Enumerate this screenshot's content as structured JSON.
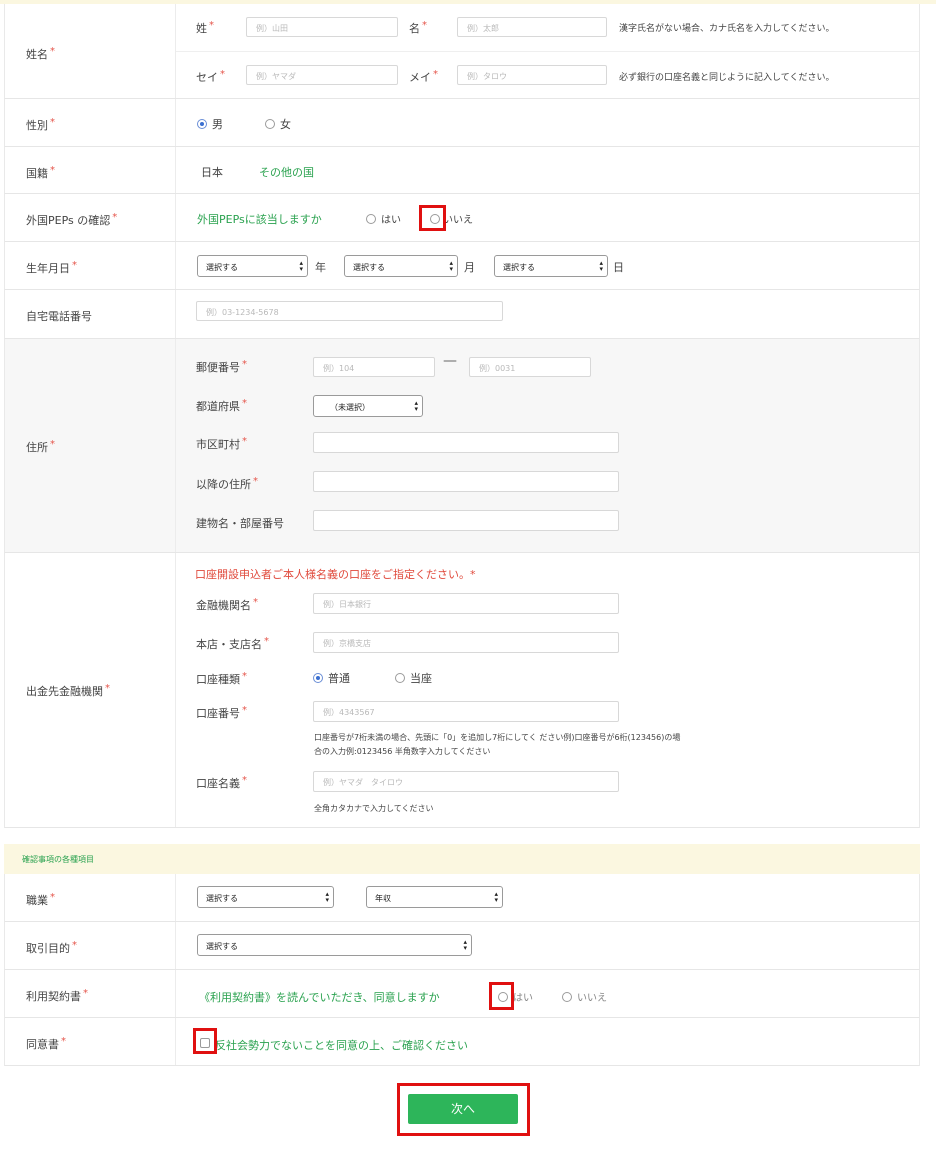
{
  "form": {
    "name": {
      "label": "姓名",
      "sei_label": "姓",
      "sei_placeholder": "例）山田",
      "mei_label": "名",
      "mei_placeholder": "例）太郎",
      "sei_kana_label": "セイ",
      "sei_kana_placeholder": "例）ヤマダ",
      "mei_kana_label": "メイ",
      "mei_kana_placeholder": "例）タロウ",
      "note1": "漢字氏名がない場合、カナ氏名を入力してください。",
      "note2": "必ず銀行の口座名義と同じように記入してください。"
    },
    "gender": {
      "label": "性別",
      "male": "男",
      "female": "女",
      "selected": "男"
    },
    "nationality": {
      "label": "国籍",
      "japan": "日本",
      "other": "その他の国"
    },
    "peps": {
      "label": "外国PEPs の確認",
      "question": "外国PEPsに該当しますか",
      "yes": "はい",
      "no": "いいえ"
    },
    "birth": {
      "label": "生年月日",
      "select": "選択する",
      "year": "年",
      "month": "月",
      "day": "日"
    },
    "phone": {
      "label": "自宅電話番号",
      "placeholder": "例）03-1234-5678"
    },
    "address": {
      "label": "住所",
      "zip_label": "郵便番号",
      "zip1_placeholder": "例）104",
      "zip_dash": "—",
      "zip2_placeholder": "例）0031",
      "pref_label": "都道府県",
      "pref_value": "（未選択）",
      "city_label": "市区町村",
      "street_label": "以降の住所",
      "building_label": "建物名・部屋番号"
    },
    "bank": {
      "label": "出金先金融機関",
      "notice": "口座開設申込者ご本人様名義の口座をご指定ください。*",
      "inst_label": "金融機関名",
      "inst_placeholder": "例）日本銀行",
      "branch_label": "本店・支店名",
      "branch_placeholder": "例）京橋支店",
      "type_label": "口座種類",
      "type_normal": "普通",
      "type_current": "当座",
      "num_label": "口座番号",
      "num_placeholder": "例）4343567",
      "num_note1": "口座番号が7桁未満の場合、先頭に「0」を追加し7桁にしてく ださい例)口座番号が6桁(123456)の場",
      "num_note2": "合の入力例:0123456 半角数字入力してください",
      "holder_label": "口座名義",
      "holder_placeholder": "例）ヤマダ　タイロウ",
      "holder_note": "全角カタカナで入力してください"
    }
  },
  "section2": {
    "header": "確認事項の各種項目",
    "job": {
      "label": "職業",
      "select1": "選択する",
      "select2": "年収"
    },
    "purpose": {
      "label": "取引目的",
      "select": "選択する"
    },
    "terms": {
      "label": "利用契約書",
      "question": "《利用契約書》を読んでいただき、同意しますか",
      "yes": "はい",
      "no": "いいえ"
    },
    "consent": {
      "label": "同意書",
      "text": "反社会勢力でないことを同意の上、ご確認ください"
    }
  },
  "submit": {
    "label": "次へ"
  },
  "colors": {
    "accent": "#2db55a",
    "required": "#e5554b",
    "highlight": "#e01010"
  }
}
